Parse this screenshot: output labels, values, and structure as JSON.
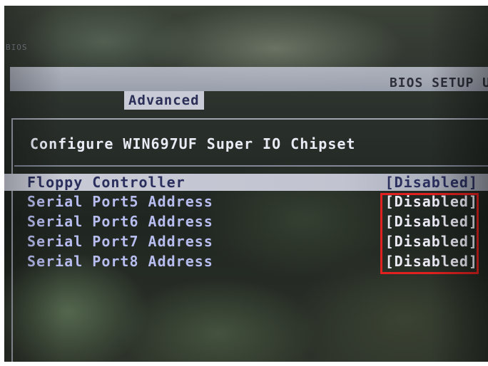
{
  "screen": {
    "corner_label": "BIOS",
    "title_bar_text": "BIOS SETUP U",
    "menu_tab_label": "Advanced"
  },
  "section": {
    "title": "Configure WIN697UF Super IO Chipset"
  },
  "settings": [
    {
      "label": "Floppy Controller",
      "value": "[Disabled]"
    },
    {
      "label": "Serial Port5 Address",
      "value": "[Disabled]"
    },
    {
      "label": "Serial Port6 Address",
      "value": "[Disabled]"
    },
    {
      "label": "Serial Port7 Address",
      "value": "[Disabled]"
    },
    {
      "label": "Serial Port8 Address",
      "value": "[Disabled]"
    }
  ],
  "colors": {
    "highlight_box": "#e0211f",
    "selected_row_bg": "#c9cbd7",
    "label_text": "#b8bdf0",
    "value_text": "#ecebf5"
  }
}
